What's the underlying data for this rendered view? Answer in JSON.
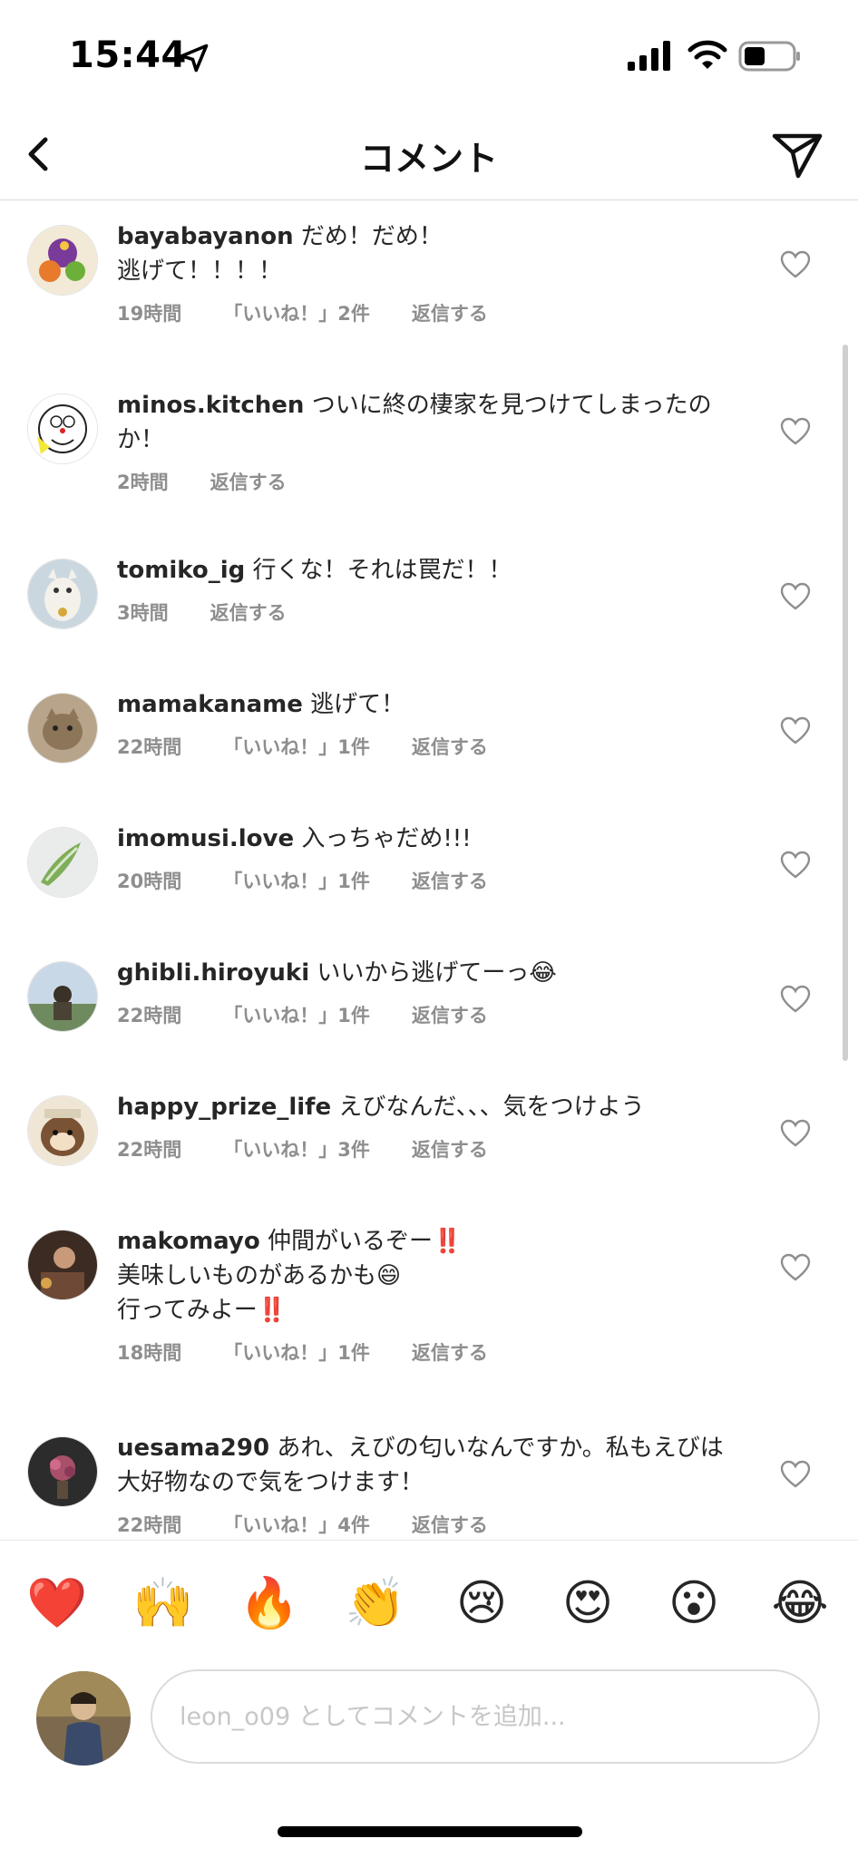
{
  "status": {
    "time": "15:44"
  },
  "header": {
    "title": "コメント"
  },
  "comments": [
    {
      "user": "bayabayanon",
      "text": "だめ！だめ！\n逃げて！！！！",
      "time": "19時間",
      "likes": "「いいね！」2件",
      "reply": "返信する"
    },
    {
      "user": "minos.kitchen",
      "text": "ついに終の棲家を見つけてしまったのか！",
      "time": "2時間",
      "likes": "",
      "reply": "返信する"
    },
    {
      "user": "tomiko_ig",
      "text": "行くな！それは罠だ！！",
      "time": "3時間",
      "likes": "",
      "reply": "返信する"
    },
    {
      "user": "mamakaname",
      "text": "逃げて！",
      "time": "22時間",
      "likes": "「いいね！」1件",
      "reply": "返信する"
    },
    {
      "user": "imomusi.love",
      "text": "入っちゃだめ!!!",
      "time": "20時間",
      "likes": "「いいね！」1件",
      "reply": "返信する"
    },
    {
      "user": "ghibli.hiroyuki",
      "text": "いいから逃げてーっ😂",
      "time": "22時間",
      "likes": "「いいね！」1件",
      "reply": "返信する"
    },
    {
      "user": "happy_prize_life",
      "text": "えびなんだ、、、気をつけよう",
      "time": "22時間",
      "likes": "「いいね！」3件",
      "reply": "返信する"
    },
    {
      "user": "makomayo",
      "text": "仲間がいるぞー‼️\n美味しいものがあるかも😄\n行ってみよー‼️",
      "time": "18時間",
      "likes": "「いいね！」1件",
      "reply": "返信する"
    },
    {
      "user": "uesama290",
      "text": "あれ、えびの匂いなんですか。私もえびは大好物なので気をつけます！",
      "time": "22時間",
      "likes": "「いいね！」4件",
      "reply": "返信する"
    }
  ],
  "reactions": [
    "❤️",
    "🙌",
    "🔥",
    "👏",
    "😢",
    "😍",
    "😮",
    "😂"
  ],
  "composer": {
    "placeholder": "leon_o09 としてコメントを追加..."
  },
  "colors": {
    "text": "#262626",
    "meta": "#8e8e8e",
    "divider": "#dbdbdb"
  }
}
